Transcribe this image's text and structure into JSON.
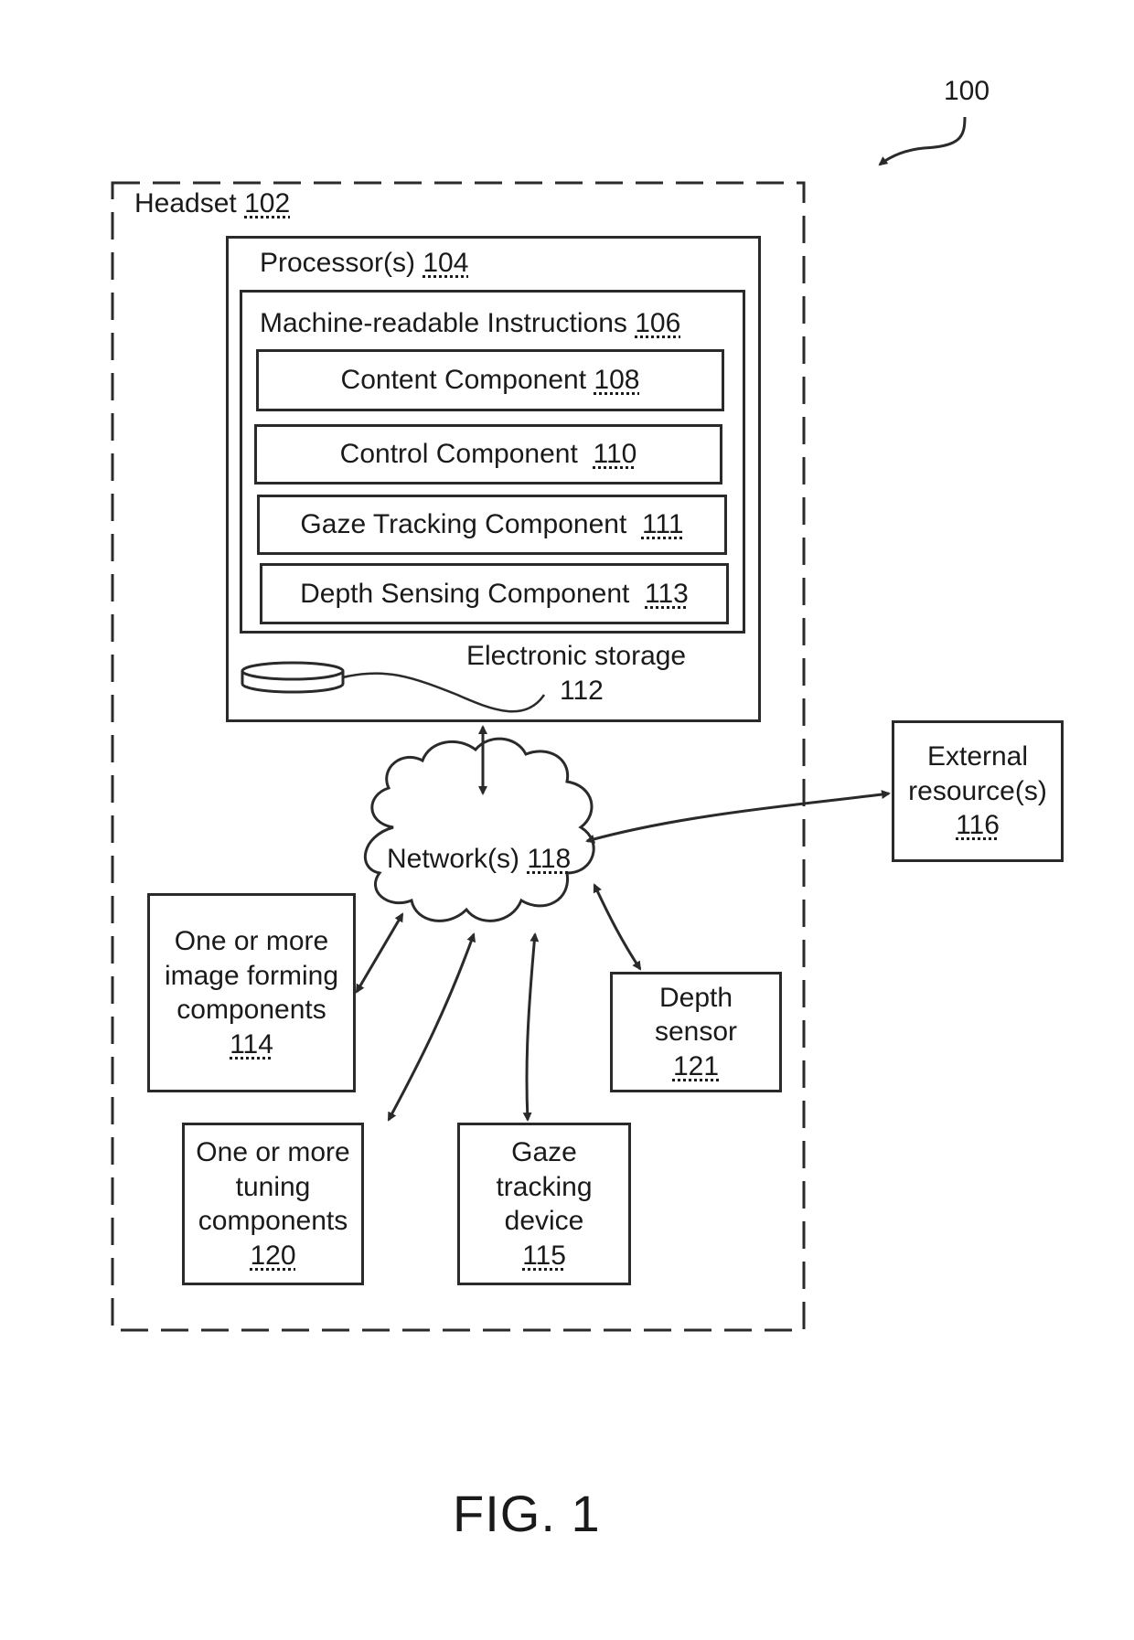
{
  "figure": {
    "reference_number": "100",
    "caption": "FIG. 1"
  },
  "headset": {
    "label": "Headset",
    "ref": "102"
  },
  "processor": {
    "label": "Processor(s)",
    "ref": "104"
  },
  "instructions": {
    "label": "Machine-readable Instructions",
    "ref": "106"
  },
  "components": [
    {
      "label": "Content Component",
      "ref": "108"
    },
    {
      "label": "Control Component",
      "ref": "110"
    },
    {
      "label": "Gaze Tracking Component",
      "ref": "111"
    },
    {
      "label": "Depth Sensing Component",
      "ref": "113"
    }
  ],
  "storage": {
    "line1": "Electronic storage",
    "ref": "112"
  },
  "network": {
    "label": "Network(s)",
    "ref": "118"
  },
  "external": {
    "line1": "External",
    "line2": "resource(s)",
    "ref": "116"
  },
  "image_forming": {
    "line1": "One or more",
    "line2": "image forming",
    "line3": "components",
    "ref": "114"
  },
  "depth_sensor": {
    "line1": "Depth",
    "line2": "sensor",
    "ref": "121"
  },
  "tuning": {
    "line1": "One or more",
    "line2": "tuning",
    "line3": "components",
    "ref": "120"
  },
  "gaze_device": {
    "line1": "Gaze",
    "line2": "tracking",
    "line3": "device",
    "ref": "115"
  }
}
